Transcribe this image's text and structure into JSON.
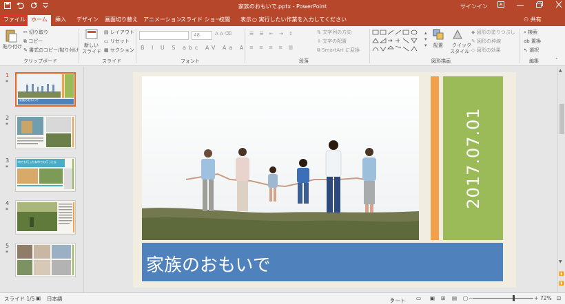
{
  "window": {
    "title": "家族のおもいで.pptx - PowerPoint",
    "signin": "サインイン",
    "qat_icons": [
      "save-icon",
      "undo-icon",
      "redo-icon",
      "customize-icon"
    ]
  },
  "tabs": [
    "ファイル",
    "ホーム",
    "挿入",
    "デザイン",
    "画面切り替え",
    "アニメーション",
    "スライド ショー",
    "校閲",
    "表示"
  ],
  "tell_me": "実行したい作業を入力してください",
  "share": "共有",
  "ribbon": {
    "clipboard": {
      "label": "クリップボード",
      "paste": "貼り付け",
      "cut": "切り取り",
      "copy": "コピー",
      "format_painter": "書式のコピー/貼り付け"
    },
    "slides": {
      "label": "スライド",
      "new_slide_1": "新しい",
      "new_slide_2": "スライド",
      "layout": "レイアウト",
      "reset": "リセット",
      "section": "セクション"
    },
    "font": {
      "label": "フォント",
      "size": "48"
    },
    "paragraph": {
      "label": "段落",
      "text_direction": "文字列の方向",
      "align_text": "文字の配置",
      "smartart": "SmartArt に変換"
    },
    "drawing": {
      "label": "図形描画",
      "arrange": "配置",
      "quick_styles_1": "クイック",
      "quick_styles_2": "スタイル",
      "shape_fill": "図形の塗りつぶし",
      "shape_outline": "図形の枠線",
      "shape_effects": "図形の効果"
    },
    "editing": {
      "label": "編集",
      "find": "検索",
      "replace": "置換",
      "select": "選択"
    }
  },
  "thumbnails": [
    {
      "num": "1",
      "star": "*",
      "caption": "家族のおもいで"
    },
    {
      "num": "2",
      "star": "*"
    },
    {
      "num": "3",
      "star": "*",
      "caption": "何でも行ったね中でも行ったな"
    },
    {
      "num": "4",
      "star": "*"
    },
    {
      "num": "5",
      "star": "*"
    }
  ],
  "slide": {
    "title": "家族のおもいで",
    "date": "2017.07.01",
    "colors": {
      "orange": "#f3a04d",
      "green": "#9bbb59",
      "blue": "#4f81bd"
    }
  },
  "status": {
    "slide_info": "スライド 1/5",
    "language": "日本語",
    "notes": "ノート",
    "zoom": "72%"
  }
}
